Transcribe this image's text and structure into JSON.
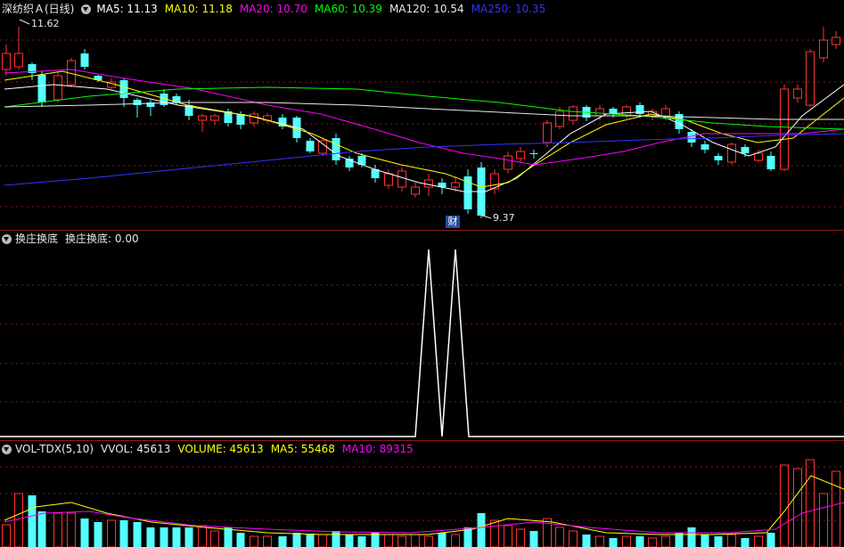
{
  "main": {
    "title": "深纺织Ａ(日线)",
    "ma": [
      {
        "label": "MA5: 11.13",
        "color": "#ffffff"
      },
      {
        "label": "MA10: 11.18",
        "color": "#ffff00"
      },
      {
        "label": "MA20: 10.70",
        "color": "#ff00ff"
      },
      {
        "label": "MA60: 10.39",
        "color": "#00ff00"
      },
      {
        "label": "MA120: 10.54",
        "color": "#e8e8e8"
      },
      {
        "label": "MA250: 10.35",
        "color": "#3333ff"
      }
    ],
    "high_label": "11.62",
    "low_label": "9.37",
    "finance_badge": "财"
  },
  "indicator": {
    "title": "换庄换底",
    "value_label": "换庄换底: 0.00"
  },
  "volume": {
    "title": "VOL-TDX(5,10)",
    "labels": [
      {
        "label": "VVOL: 45613",
        "color": "#e8e8e8"
      },
      {
        "label": "VOLUME: 45613",
        "color": "#ffff00"
      },
      {
        "label": "MA5: 55468",
        "color": "#ffff00"
      },
      {
        "label": "MA10: 89315",
        "color": "#ff00ff"
      }
    ]
  },
  "colors": {
    "up": "#ff3232",
    "down": "#54ffff",
    "grid": "#8c1a1a",
    "ma5": "#ffffff",
    "ma10": "#ffff00",
    "ma20": "#ff00ff",
    "ma60": "#00ff00",
    "ma120": "#e8e8e8",
    "ma250": "#3333ff"
  }
}
